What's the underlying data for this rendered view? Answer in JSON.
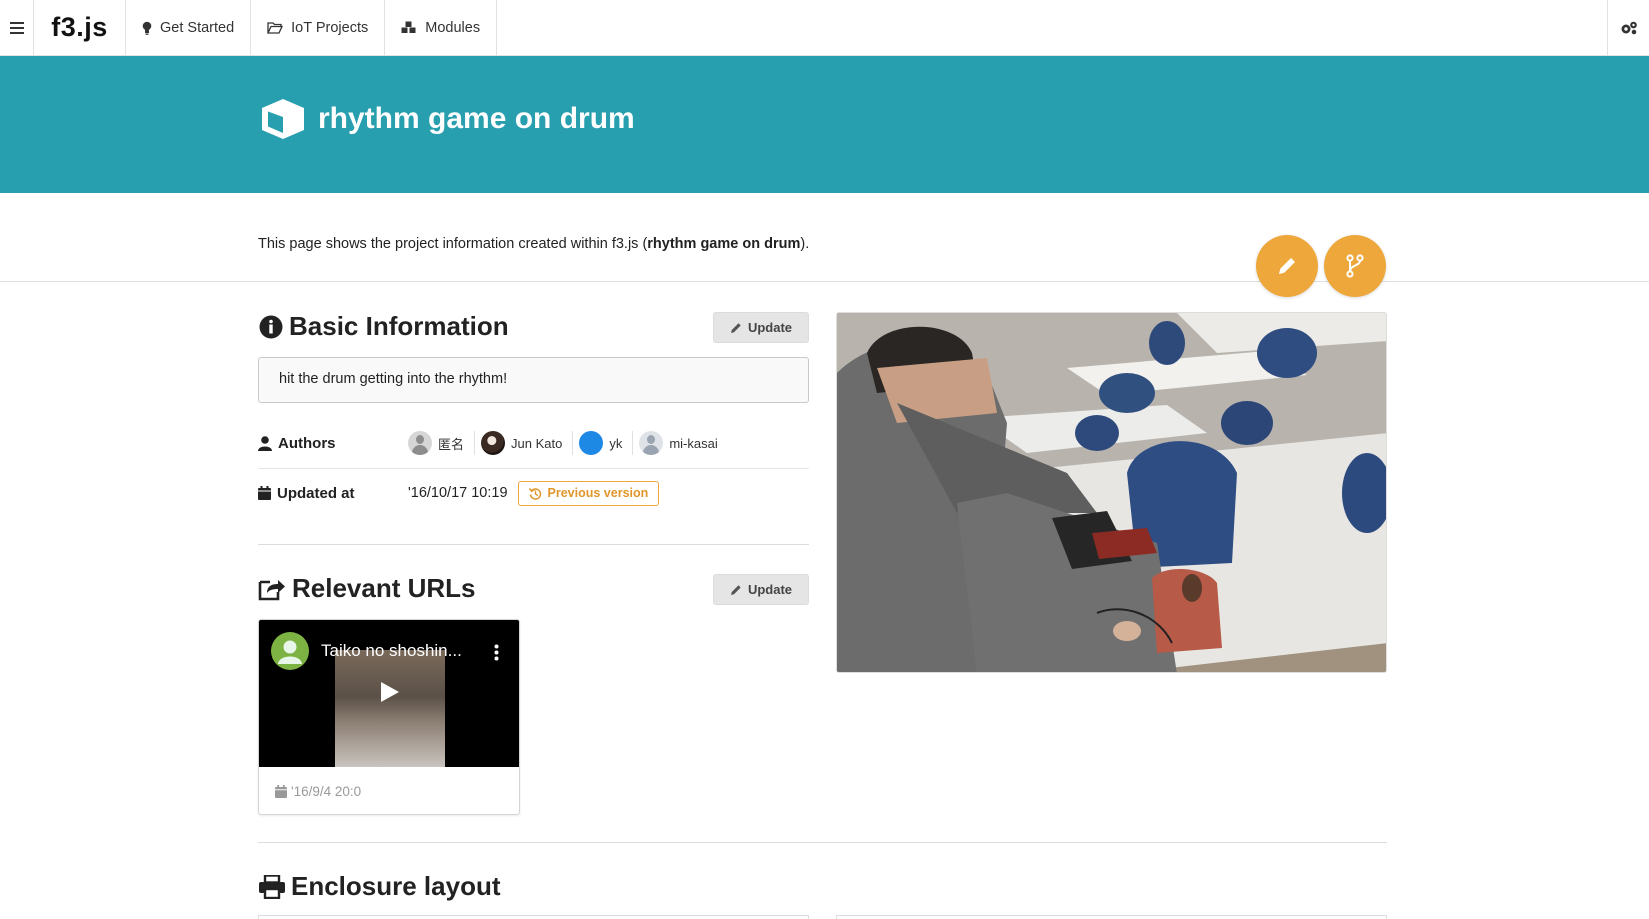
{
  "navbar": {
    "logo": "f3.js",
    "items": [
      {
        "label": "Get Started",
        "icon": "lightbulb-icon"
      },
      {
        "label": "IoT Projects",
        "icon": "folder-open-icon"
      },
      {
        "label": "Modules",
        "icon": "cubes-icon"
      }
    ],
    "menu_icon": "hamburger-menu-icon",
    "settings_icon": "gears-icon"
  },
  "header": {
    "title": "rhythm game on drum",
    "icon": "cube-icon",
    "background": "#279fae"
  },
  "intro": {
    "prefix": "This page shows the project information created within f3.js (",
    "project_name": "rhythm game on drum",
    "suffix": ")."
  },
  "actions": {
    "edit_icon": "pencil-icon",
    "fork_icon": "code-fork-icon",
    "accent": "#eda73b"
  },
  "basic_info": {
    "title": "Basic Information",
    "update_label": "Update",
    "description": "hit the drum getting into the rhythm!",
    "authors_label": "Authors",
    "authors": [
      {
        "name": "匿名"
      },
      {
        "name": "Jun Kato"
      },
      {
        "name": "yk"
      },
      {
        "name": "mi-kasai"
      }
    ],
    "updated_label": "Updated at",
    "updated_value": "'16/10/17 10:19",
    "previous_version_label": "Previous version"
  },
  "relevant_urls": {
    "title": "Relevant URLs",
    "update_label": "Update",
    "video": {
      "title": "Taiko no shoshin...",
      "date": "'16/9/4 20:0"
    }
  },
  "enclosure": {
    "title": "Enclosure layout"
  }
}
